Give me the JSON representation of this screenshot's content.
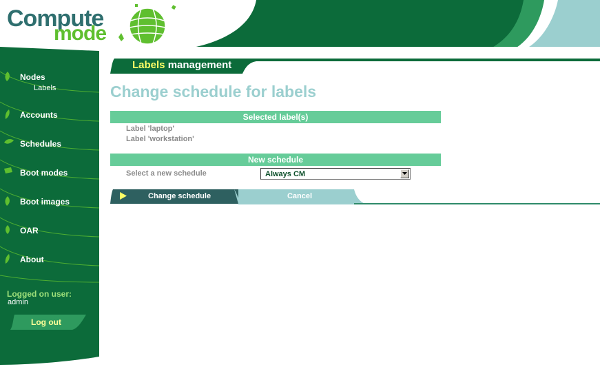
{
  "brand": {
    "line1": "Compute",
    "line2": "mode",
    "colors": {
      "dark_green": "#0c6b3a",
      "light_green": "#66cc99",
      "teal": "#9bcfcf",
      "lime": "#5fbf2f"
    }
  },
  "sidebar": {
    "items": [
      {
        "label": "Nodes",
        "icon": "leaf-icon"
      },
      {
        "label": "Accounts",
        "icon": "leaf-icon"
      },
      {
        "label": "Schedules",
        "icon": "leaf-icon"
      },
      {
        "label": "Boot modes",
        "icon": "leaf-icon"
      },
      {
        "label": "Boot images",
        "icon": "leaf-icon"
      },
      {
        "label": "OAR",
        "icon": "leaf-icon"
      },
      {
        "label": "About",
        "icon": "leaf-icon"
      }
    ],
    "sub_items": [
      {
        "label": "Labels"
      }
    ],
    "logged_label": "Logged on user:",
    "logged_user": "admin",
    "logout_label": "Log out"
  },
  "main": {
    "header": {
      "highlight": "Labels",
      "rest": " management"
    },
    "title": "Change schedule for labels",
    "selected_section": "Selected label(s)",
    "labels": [
      "Label 'laptop'",
      "Label 'workstation'"
    ],
    "new_schedule_section": "New schedule",
    "select_label": "Select a new schedule",
    "select_value": "Always CM",
    "change_button": "Change schedule",
    "cancel_button": "Cancel"
  }
}
